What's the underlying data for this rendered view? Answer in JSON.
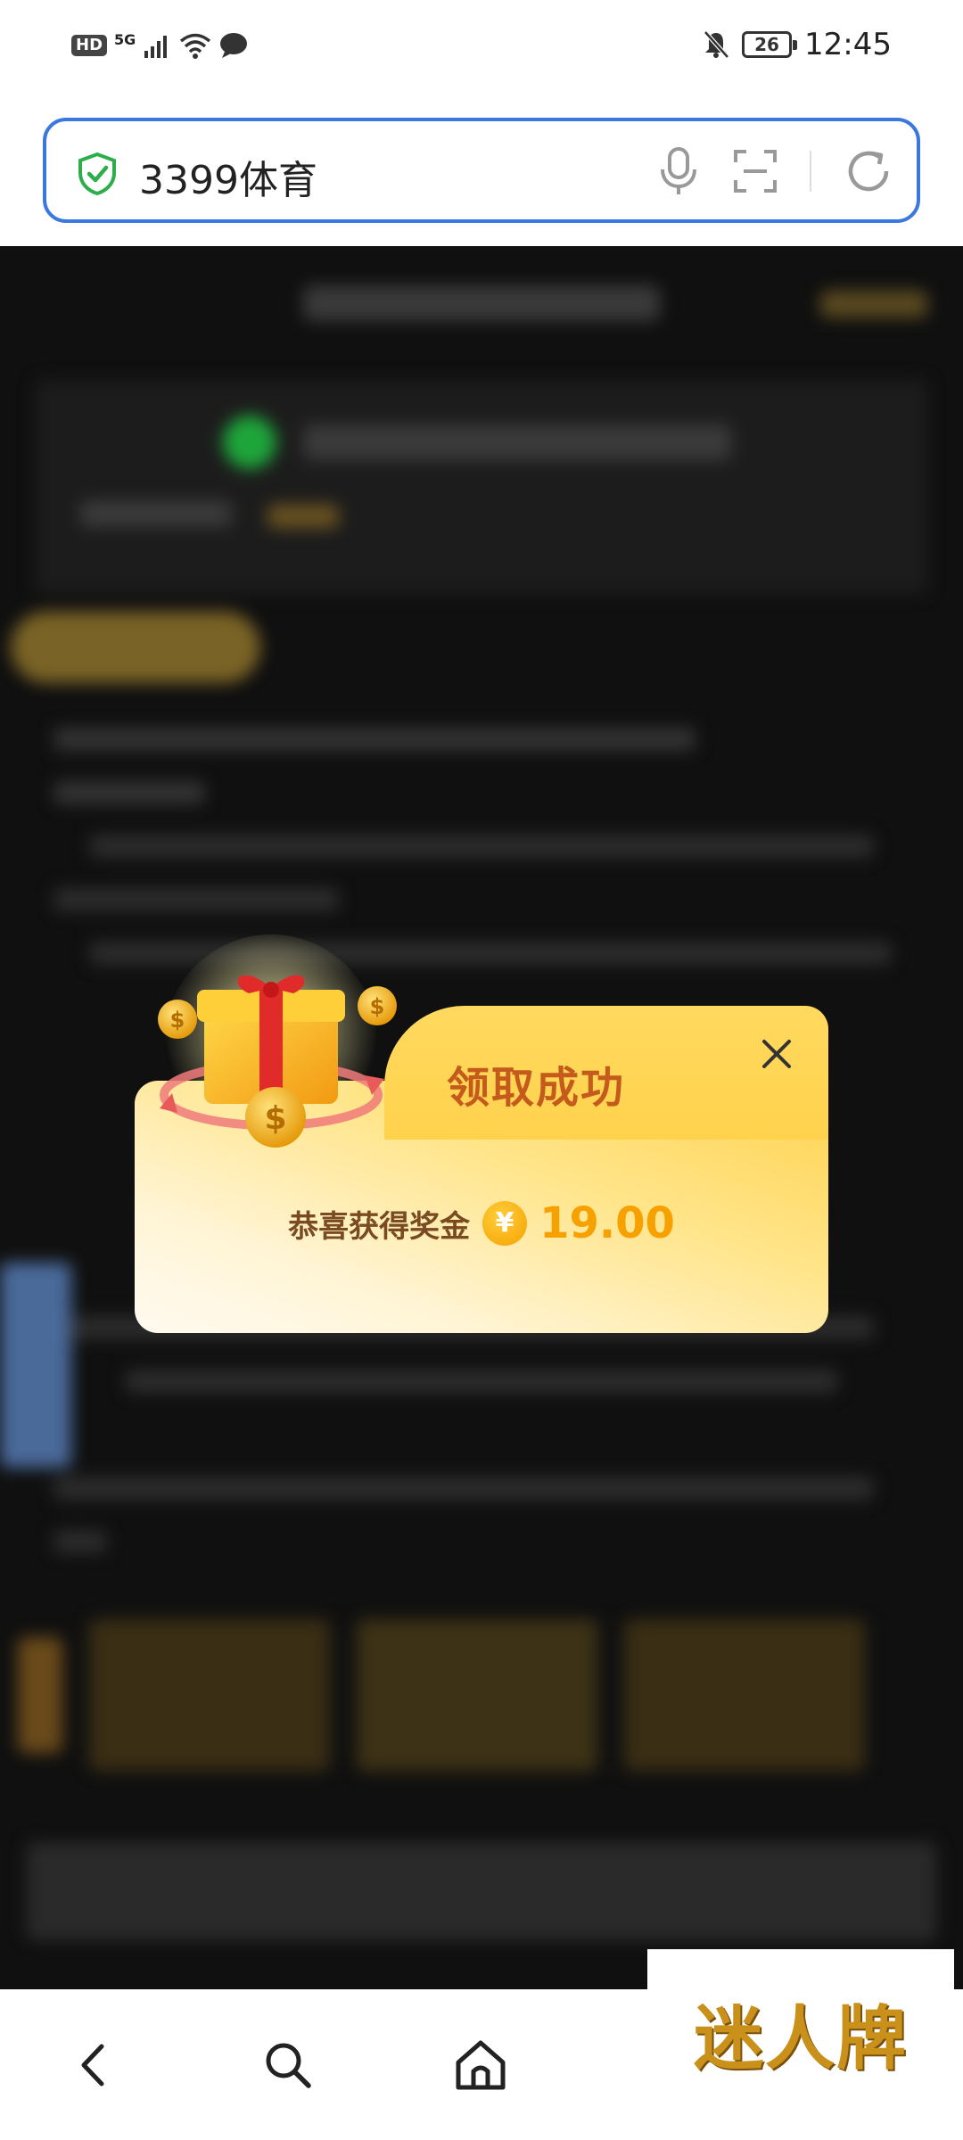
{
  "status_bar": {
    "hd": "HD",
    "network": "5G",
    "battery": "26",
    "time": "12:45"
  },
  "address_bar": {
    "text": "3399体育"
  },
  "modal": {
    "title": "领取成功",
    "reward_label": "恭喜获得奖金",
    "currency_symbol": "¥",
    "amount": "19.00"
  },
  "watermark": "迷人牌",
  "colors": {
    "accent_blue": "#3a78e0",
    "modal_gold": "#ffd24d",
    "title_orange": "#c45a1c",
    "amount_orange": "#f6a100"
  },
  "icons": [
    "shield-check-icon",
    "microphone-icon",
    "scan-icon",
    "reload-icon",
    "back-icon",
    "search-icon",
    "home-icon",
    "close-icon",
    "gift-icon"
  ]
}
